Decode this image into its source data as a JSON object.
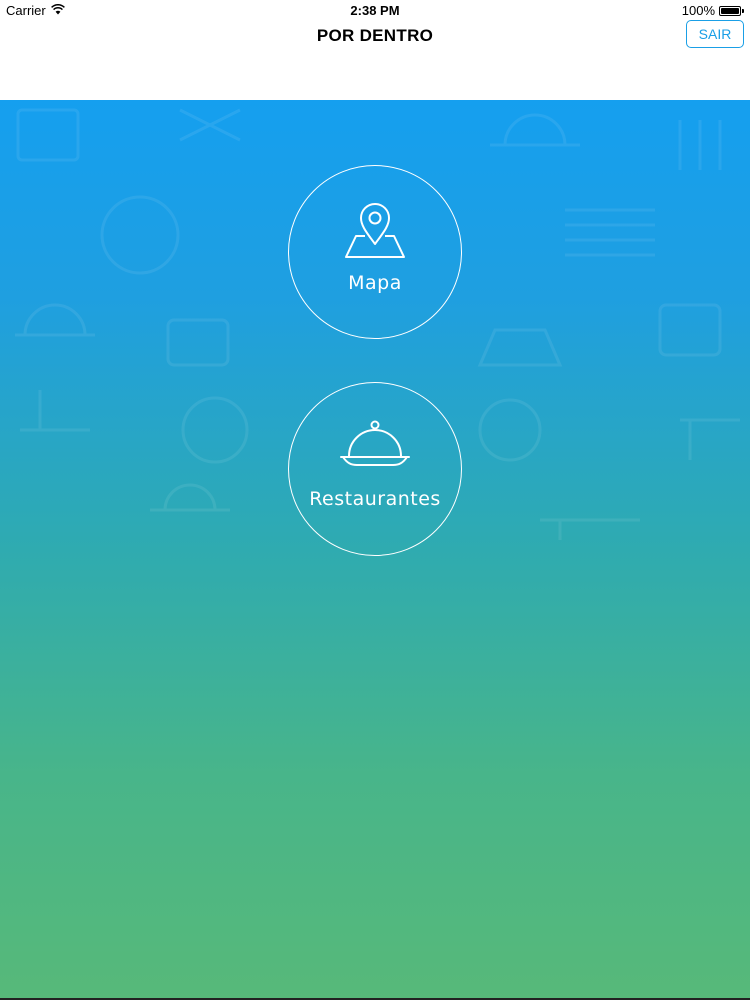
{
  "status_bar": {
    "carrier": "Carrier",
    "time": "2:38 PM",
    "battery": "100%",
    "battery_level": 1.0
  },
  "nav": {
    "title": "POR DENTRO",
    "logout_label": "SAIR",
    "accent_color": "#1a9fe6"
  },
  "menu": {
    "map_label": "Mapa",
    "map_icon": "map-pin-icon",
    "restaurants_label": "Restaurantes",
    "restaurants_icon": "food-cloche-icon"
  },
  "colors": {
    "gradient_top": "#159fef",
    "gradient_bottom": "#57b979"
  }
}
